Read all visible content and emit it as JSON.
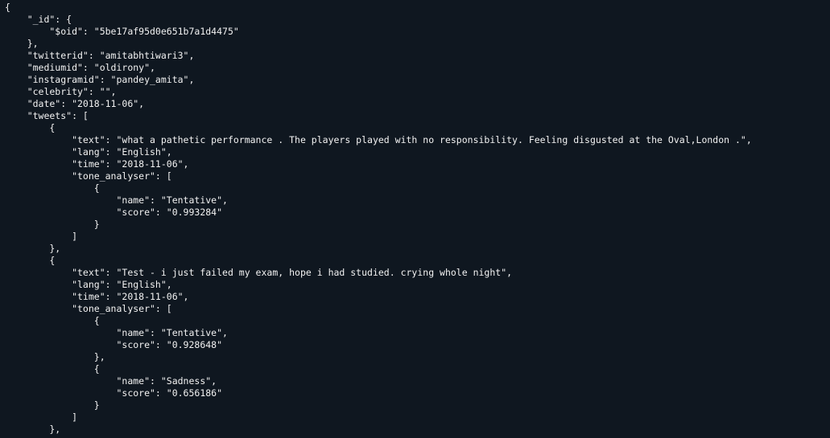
{
  "document": {
    "lines": [
      "{",
      "    \"_id\": {",
      "        \"$oid\": \"5be17af95d0e651b7a1d4475\"",
      "    },",
      "    \"twitterid\": \"amitabhtiwari3\",",
      "    \"mediumid\": \"oldirony\",",
      "    \"instagramid\": \"pandey_amita\",",
      "    \"celebrity\": \"\",",
      "    \"date\": \"2018-11-06\",",
      "    \"tweets\": [",
      "        {",
      "            \"text\": \"what a pathetic performance . The players played with no responsibility. Feeling disgusted at the Oval,London .\",",
      "            \"lang\": \"English\",",
      "            \"time\": \"2018-11-06\",",
      "            \"tone_analyser\": [",
      "                {",
      "                    \"name\": \"Tentative\",",
      "                    \"score\": \"0.993284\"",
      "                }",
      "            ]",
      "        },",
      "        {",
      "            \"text\": \"Test - i just failed my exam, hope i had studied. crying whole night\",",
      "            \"lang\": \"English\",",
      "            \"time\": \"2018-11-06\",",
      "            \"tone_analyser\": [",
      "                {",
      "                    \"name\": \"Tentative\",",
      "                    \"score\": \"0.928648\"",
      "                },",
      "                {",
      "                    \"name\": \"Sadness\",",
      "                    \"score\": \"0.656186\"",
      "                }",
      "            ]",
      "        },"
    ]
  }
}
